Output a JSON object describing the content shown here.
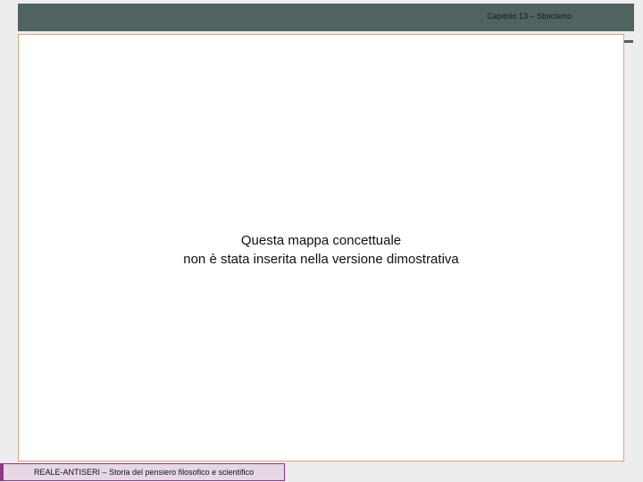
{
  "header": {
    "chapter": "Capitolo 13 – Stoicismo"
  },
  "content": {
    "line1": "Questa mappa concettuale",
    "line2": "non è stata inserita nella versione dimostrativa"
  },
  "footer": {
    "label": "REALE-ANTISERI – Storia del pensiero filosofico e scientifico"
  },
  "colors": {
    "header_bar": "#4f6460",
    "content_border": "#d9a77a",
    "footer_accent": "#8e3a86",
    "footer_bg": "#e5d7e4"
  }
}
